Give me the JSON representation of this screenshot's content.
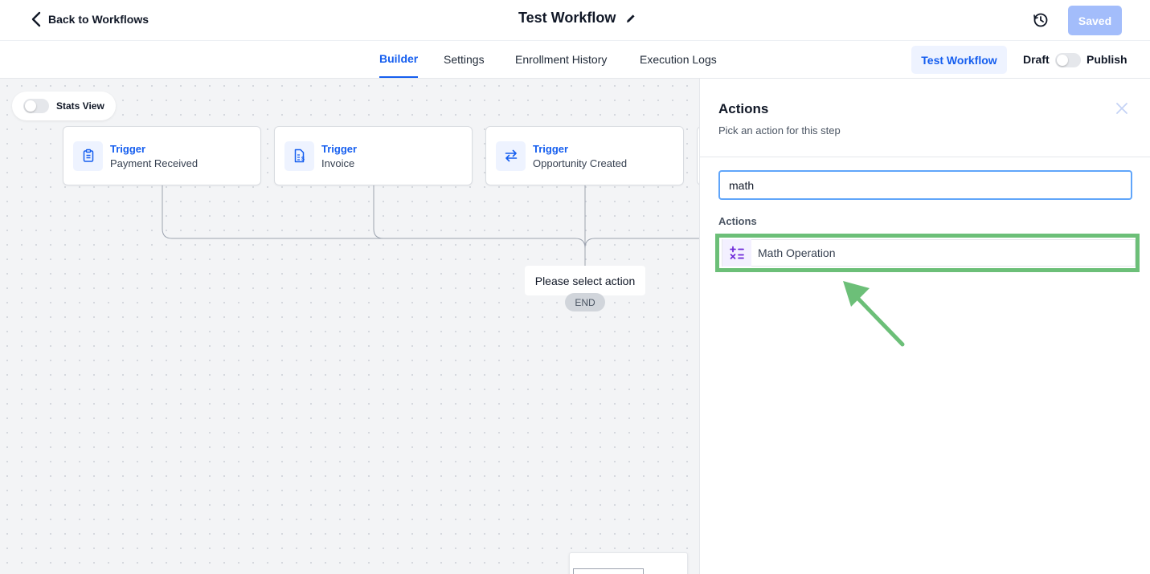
{
  "header": {
    "back_label": "Back to Workflows",
    "title": "Test Workflow",
    "saved_label": "Saved"
  },
  "tabs": [
    {
      "label": "Builder",
      "active": true
    },
    {
      "label": "Settings",
      "active": false
    },
    {
      "label": "Enrollment History",
      "active": false
    },
    {
      "label": "Execution Logs",
      "active": false
    }
  ],
  "toolbar": {
    "test_label": "Test Workflow",
    "draft_label": "Draft",
    "publish_label": "Publish",
    "published": false
  },
  "canvas": {
    "stats_label": "Stats View",
    "stats_enabled": false,
    "triggers": [
      {
        "kind": "Trigger",
        "name": "Payment Received",
        "icon": "clipboard-icon"
      },
      {
        "kind": "Trigger",
        "name": "Invoice",
        "icon": "invoice-icon"
      },
      {
        "kind": "Trigger",
        "name": "Opportunity Created",
        "icon": "swap-arrows-icon"
      }
    ],
    "select_action_label": "Please select action",
    "end_label": "END"
  },
  "panel": {
    "title": "Actions",
    "subtitle": "Pick an action for this step",
    "search_value": "math",
    "section_label": "Actions",
    "results": [
      {
        "label": "Math Operation",
        "icon": "math-operation-icon"
      }
    ]
  },
  "colors": {
    "primary": "#155eef",
    "saved_button": "#a3bdfb",
    "highlight": "#6cbf78",
    "math_icon": "#6d28d9"
  }
}
